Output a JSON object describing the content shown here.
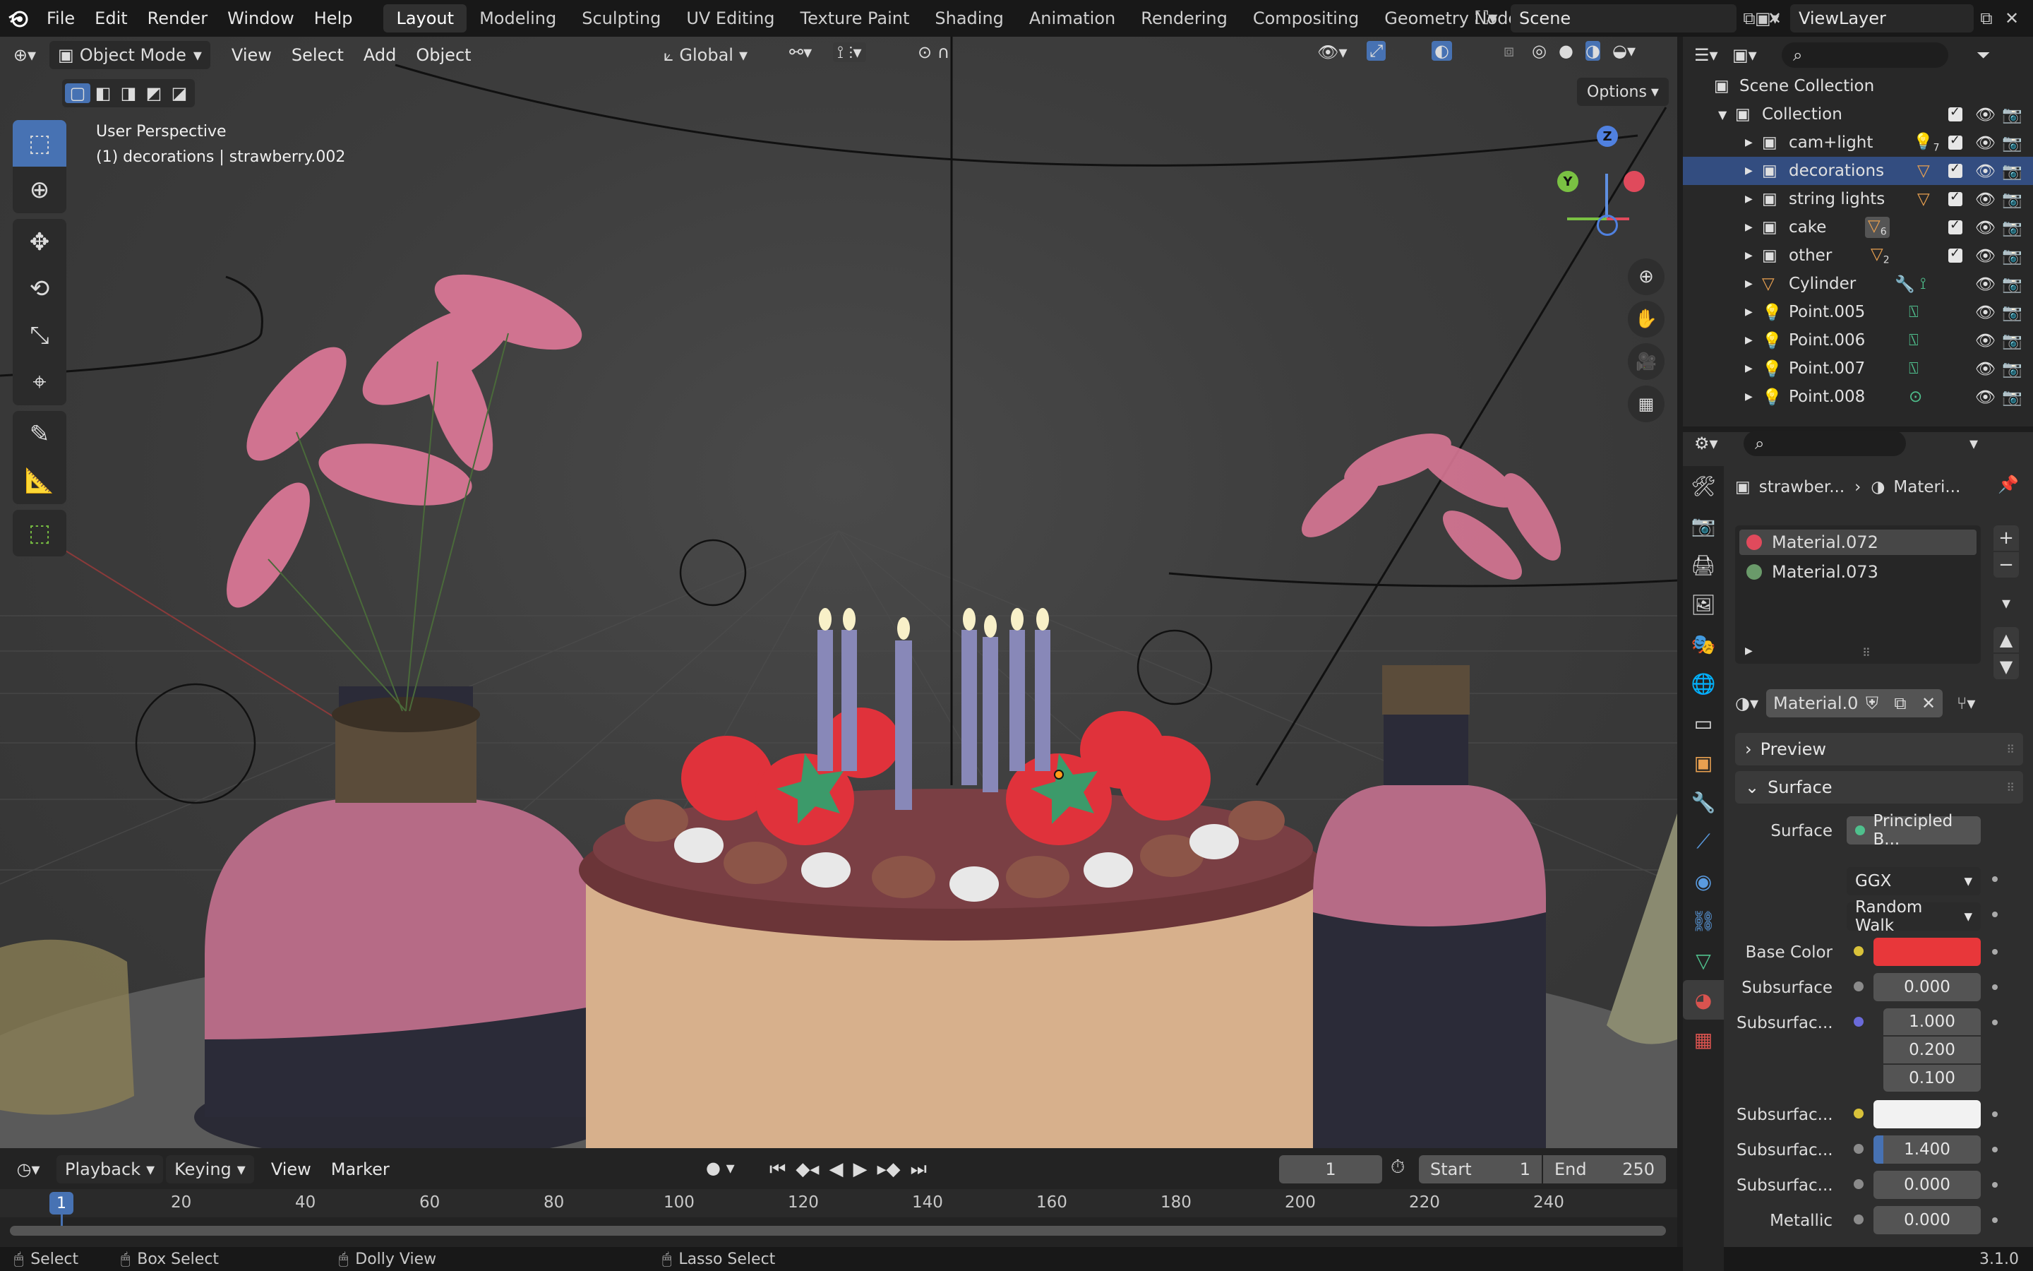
{
  "topbar": {
    "menus": [
      "File",
      "Edit",
      "Render",
      "Window",
      "Help"
    ],
    "workspaces": [
      "Layout",
      "Modeling",
      "Sculpting",
      "UV Editing",
      "Texture Paint",
      "Shading",
      "Animation",
      "Rendering",
      "Compositing",
      "Geometry Nodes"
    ],
    "active_workspace": "Layout",
    "scene": "Scene",
    "view_layer": "ViewLayer"
  },
  "viewport": {
    "mode": "Object Mode",
    "menus": [
      "View",
      "Select",
      "Add",
      "Object"
    ],
    "orientation": "Global",
    "options_label": "Options",
    "overlay_title": "User Perspective",
    "overlay_subtitle": "(1) decorations | strawberry.002",
    "gizmo_axes": {
      "z": "Z",
      "y": "Y",
      "x": "X"
    }
  },
  "timeline": {
    "menus": [
      "Playback",
      "Keying",
      "View",
      "Marker"
    ],
    "current_frame": "1",
    "start_label": "Start",
    "start_value": "1",
    "end_label": "End",
    "end_value": "250",
    "ticks": [
      "1",
      "20",
      "40",
      "60",
      "80",
      "100",
      "120",
      "140",
      "160",
      "180",
      "200",
      "220",
      "240"
    ]
  },
  "statusbar": {
    "select": "Select",
    "box_select": "Box Select",
    "dolly_view": "Dolly View",
    "lasso_select": "Lasso Select",
    "version": "3.1.0"
  },
  "outliner": {
    "scene_collection": "Scene Collection",
    "collection": "Collection",
    "items": [
      {
        "label": "cam+light",
        "badge": "7"
      },
      {
        "label": "decorations",
        "badge": ""
      },
      {
        "label": "string lights",
        "badge": ""
      },
      {
        "label": "cake",
        "badge": "6"
      },
      {
        "label": "other",
        "badge": "2"
      },
      {
        "label": "Cylinder",
        "badge": ""
      },
      {
        "label": "Point.005",
        "badge": ""
      },
      {
        "label": "Point.006",
        "badge": ""
      },
      {
        "label": "Point.007",
        "badge": ""
      },
      {
        "label": "Point.008",
        "badge": ""
      }
    ]
  },
  "properties": {
    "breadcrumb_object": "strawber...",
    "breadcrumb_material": "Materi...",
    "material_slots": [
      "Material.072",
      "Material.073"
    ],
    "material_name": "Material.0...",
    "preview_label": "Preview",
    "surface_panel": "Surface",
    "surface_label": "Surface",
    "surface_value": "Principled B...",
    "distribution": "GGX",
    "subsurface_method": "Random Walk",
    "fields": [
      {
        "label": "Base Color",
        "value": ""
      },
      {
        "label": "Subsurface",
        "value": "0.000"
      },
      {
        "label": "Subsurfac...",
        "value": "1.000"
      },
      {
        "label": "",
        "value": "0.200"
      },
      {
        "label": "",
        "value": "0.100"
      },
      {
        "label": "Subsurfac...",
        "value": ""
      },
      {
        "label": "Subsurfac...",
        "value": "1.400"
      },
      {
        "label": "Subsurfac...",
        "value": "0.000"
      },
      {
        "label": "Metallic",
        "value": "0.000"
      }
    ],
    "base_color": "#e8373a"
  },
  "colors": {
    "accent": "#4772b3",
    "selection": "#334d80",
    "timeline_cursor": "#4772b3"
  }
}
